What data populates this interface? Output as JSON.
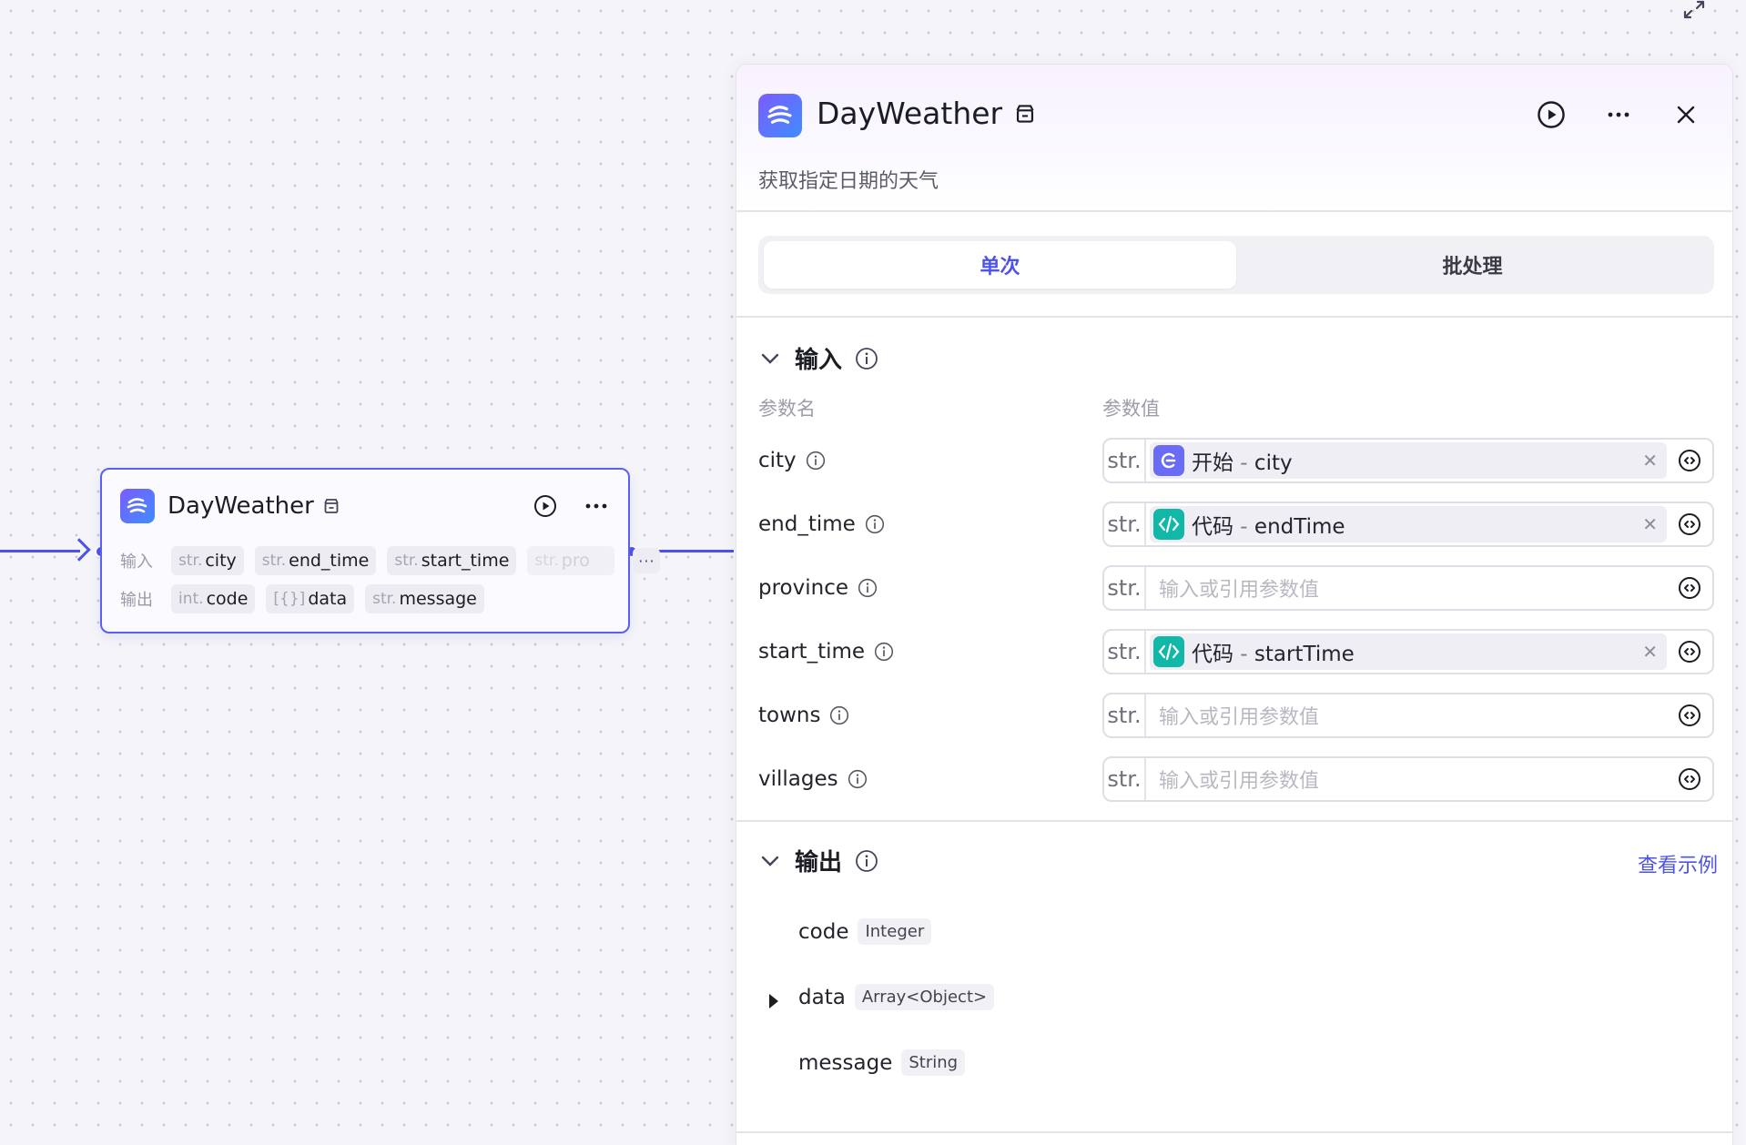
{
  "canvas": {
    "node": {
      "title": "DayWeather",
      "input_label": "输入",
      "output_label": "输出",
      "inputs": [
        {
          "type": "str.",
          "name": "city"
        },
        {
          "type": "str.",
          "name": "end_time"
        },
        {
          "type": "str.",
          "name": "start_time"
        },
        {
          "type": "str.",
          "name": "pro"
        }
      ],
      "more_label": "···",
      "outputs": [
        {
          "type": "int.",
          "name": "code"
        },
        {
          "type": "[{}]",
          "name": "data"
        },
        {
          "type": "str.",
          "name": "message"
        }
      ]
    }
  },
  "panel": {
    "title": "DayWeather",
    "description": "获取指定日期的天气",
    "tabs": [
      {
        "label": "单次",
        "active": true
      },
      {
        "label": "批处理",
        "active": false
      }
    ],
    "input_section": {
      "title": "输入",
      "col_name": "参数名",
      "col_value": "参数值",
      "params": [
        {
          "name": "city",
          "type": "str.",
          "ref_kind": "start",
          "ref_node": "开始",
          "ref_var": "city",
          "placeholder": ""
        },
        {
          "name": "end_time",
          "type": "str.",
          "ref_kind": "code",
          "ref_node": "代码",
          "ref_var": "endTime",
          "placeholder": ""
        },
        {
          "name": "province",
          "type": "str.",
          "ref_kind": "",
          "ref_node": "",
          "ref_var": "",
          "placeholder": "输入或引用参数值"
        },
        {
          "name": "start_time",
          "type": "str.",
          "ref_kind": "code",
          "ref_node": "代码",
          "ref_var": "startTime",
          "placeholder": ""
        },
        {
          "name": "towns",
          "type": "str.",
          "ref_kind": "",
          "ref_node": "",
          "ref_var": "",
          "placeholder": "输入或引用参数值"
        },
        {
          "name": "villages",
          "type": "str.",
          "ref_kind": "",
          "ref_node": "",
          "ref_var": "",
          "placeholder": "输入或引用参数值"
        }
      ]
    },
    "output_section": {
      "title": "输出",
      "example_link": "查看示例",
      "outputs": [
        {
          "name": "code",
          "type": "Integer",
          "expandable": false
        },
        {
          "name": "data",
          "type": "Array<Object>",
          "expandable": true
        },
        {
          "name": "message",
          "type": "String",
          "expandable": false
        }
      ]
    }
  },
  "colors": {
    "accent": "#4e53e8",
    "start_ref": "#6a6cf6",
    "code_ref": "#11b8a8"
  }
}
